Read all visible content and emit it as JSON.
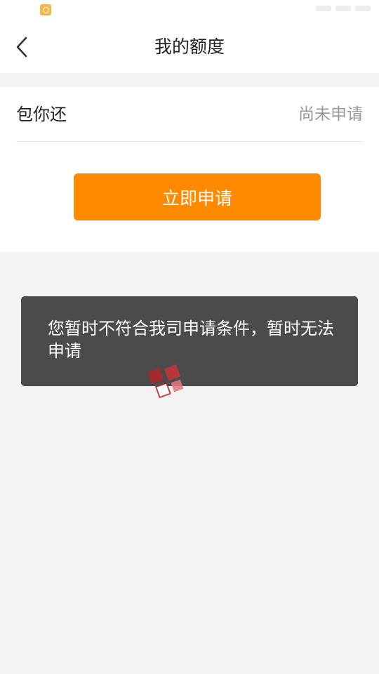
{
  "header": {
    "title": "我的额度"
  },
  "product": {
    "name": "包你还",
    "status": "尚未申请"
  },
  "actions": {
    "apply_label": "立即申请"
  },
  "toast": {
    "message": "您暂时不符合我司申请条件，暂时无法申请"
  },
  "icons": {
    "back": "chevron-left-icon",
    "status_app": "app-notification-icon"
  },
  "colors": {
    "accent": "#ff8a00",
    "toast_bg": "#4b4b4b",
    "page_bg": "#f3f3f3",
    "muted_text": "#999999"
  }
}
